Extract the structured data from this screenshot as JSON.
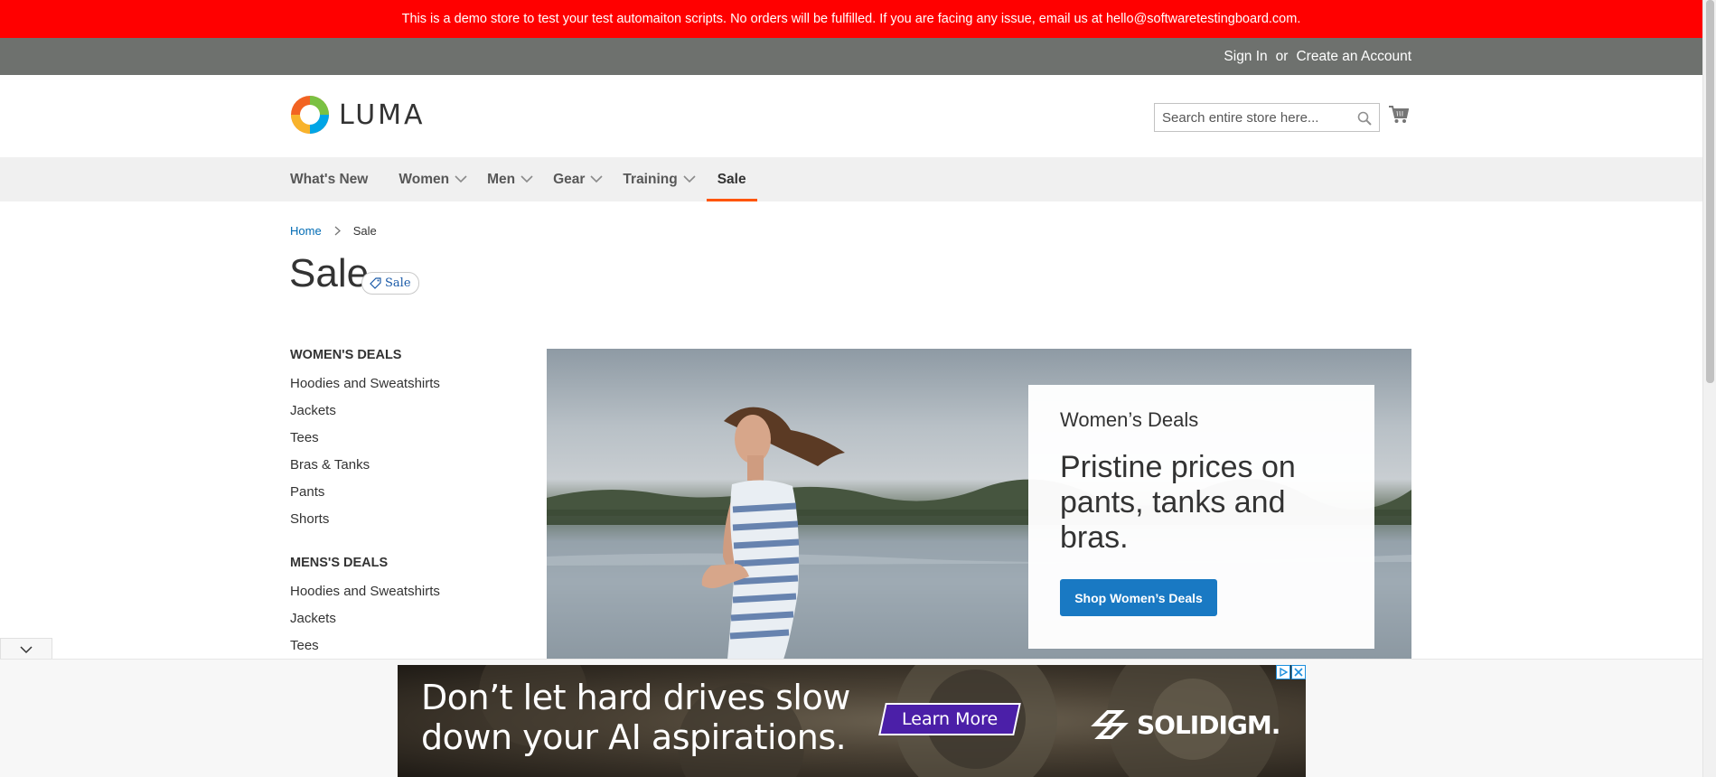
{
  "banner": {
    "text": "This is a demo store to test your test automaiton scripts. No orders will be fulfilled. If you are facing any issue, email us at hello@softwaretestingboard.com."
  },
  "header": {
    "sign_in": "Sign In",
    "or": "or",
    "create_account": "Create an Account",
    "logo_text": "LUMA",
    "search_placeholder": "Search entire store here...",
    "search_value": ""
  },
  "nav": {
    "items": [
      {
        "label": "What's New"
      },
      {
        "label": "Women"
      },
      {
        "label": "Men"
      },
      {
        "label": "Gear"
      },
      {
        "label": "Training"
      },
      {
        "label": "Sale"
      }
    ]
  },
  "breadcrumb": {
    "home": "Home",
    "current": "Sale"
  },
  "page": {
    "title": "Sale",
    "badge": "Sale"
  },
  "sidebar": {
    "womens_heading": "WOMEN'S DEALS",
    "womens_items": [
      "Hoodies and Sweatshirts",
      "Jackets",
      "Tees",
      "Bras & Tanks",
      "Pants",
      "Shorts"
    ],
    "mens_heading": "MENS'S DEALS",
    "mens_items": [
      "Hoodies and Sweatshirts",
      "Jackets",
      "Tees"
    ]
  },
  "promo": {
    "title": "Women’s Deals",
    "headline_1": "Pristine prices on",
    "headline_2": "pants, tanks and",
    "headline_3": "bras.",
    "button": "Shop Women’s Deals"
  },
  "ad": {
    "headline_1": "Don’t let hard drives slow",
    "headline_2": "down your AI aspirations.",
    "cta": "Learn More",
    "brand": "SOLIDIGM."
  },
  "colors": {
    "banner_bg": "#ff0000",
    "header_bar": "#6e716e",
    "link": "#006bb4",
    "button": "#1979c3",
    "active_nav": "#ff5501",
    "ad_cta": "#4b1fa8"
  }
}
